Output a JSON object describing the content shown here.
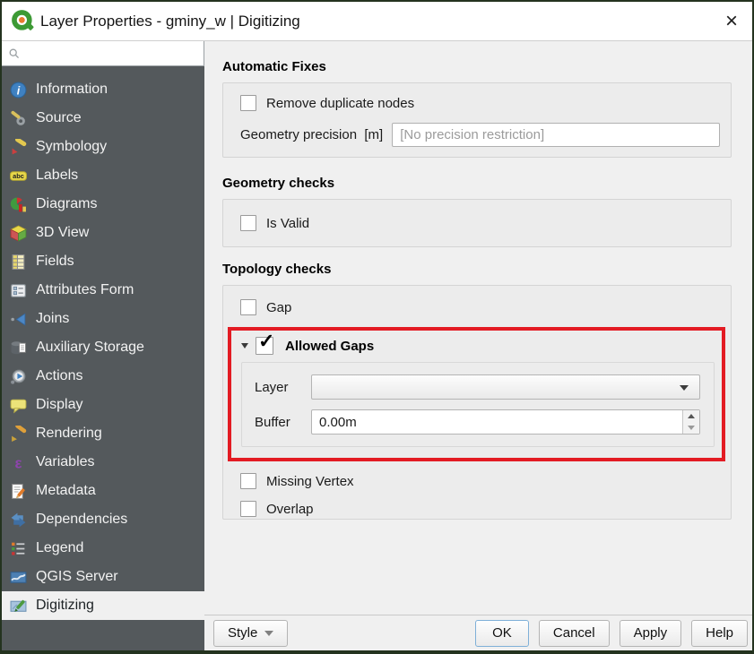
{
  "window": {
    "title": "Layer Properties - gminy_w | Digitizing"
  },
  "search": {
    "value": "",
    "placeholder": ""
  },
  "sidebar": {
    "items": [
      {
        "label": "Information",
        "icon": "information"
      },
      {
        "label": "Source",
        "icon": "source"
      },
      {
        "label": "Symbology",
        "icon": "symbology"
      },
      {
        "label": "Labels",
        "icon": "labels"
      },
      {
        "label": "Diagrams",
        "icon": "diagrams"
      },
      {
        "label": "3D View",
        "icon": "3d-view"
      },
      {
        "label": "Fields",
        "icon": "fields"
      },
      {
        "label": "Attributes Form",
        "icon": "attributes-form"
      },
      {
        "label": "Joins",
        "icon": "joins"
      },
      {
        "label": "Auxiliary Storage",
        "icon": "auxiliary-storage"
      },
      {
        "label": "Actions",
        "icon": "actions"
      },
      {
        "label": "Display",
        "icon": "display"
      },
      {
        "label": "Rendering",
        "icon": "rendering"
      },
      {
        "label": "Variables",
        "icon": "variables"
      },
      {
        "label": "Metadata",
        "icon": "metadata"
      },
      {
        "label": "Dependencies",
        "icon": "dependencies"
      },
      {
        "label": "Legend",
        "icon": "legend"
      },
      {
        "label": "QGIS Server",
        "icon": "qgis-server"
      },
      {
        "label": "Digitizing",
        "icon": "digitizing",
        "selected": true
      }
    ],
    "selected": "Digitizing"
  },
  "main": {
    "automatic_fixes": {
      "title": "Automatic Fixes",
      "remove_duplicate_nodes": "Remove duplicate nodes",
      "geometry_precision_label": "Geometry precision  [m]",
      "geometry_precision_placeholder": "[No precision restriction]"
    },
    "geometry_checks": {
      "title": "Geometry checks",
      "is_valid": "Is Valid"
    },
    "topology_checks": {
      "title": "Topology checks",
      "gap": "Gap",
      "allowed_gaps": {
        "label": "Allowed Gaps",
        "checked": true,
        "layer_label": "Layer",
        "layer_value": "",
        "buffer_label": "Buffer",
        "buffer_value": "0.00m"
      },
      "missing_vertex": "Missing Vertex",
      "overlap": "Overlap"
    }
  },
  "footer": {
    "style": "Style",
    "ok": "OK",
    "cancel": "Cancel",
    "apply": "Apply",
    "help": "Help"
  },
  "icons": {
    "close": "×",
    "check": "✓"
  },
  "colors": {
    "sidebar_bg": "#54595c",
    "selected_item_bg": "#f0f0f0",
    "annotation_red": "#e31b23",
    "ok_focus_border": "#7fb0d8",
    "panel_bg": "#f0f0f0",
    "groupbox_bg": "#ececec",
    "placeholder_gray": "#9b9b9b"
  }
}
